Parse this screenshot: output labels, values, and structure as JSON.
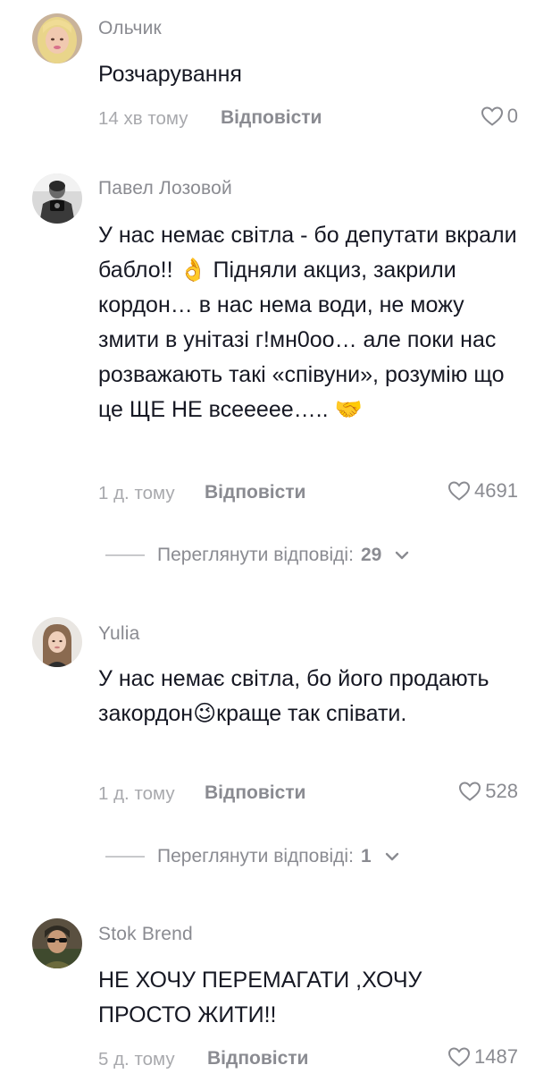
{
  "comments": [
    {
      "username": "Ольчик",
      "text": "Розчарування",
      "time": "14 хв тому",
      "reply_label": "Відповісти",
      "likes": "0",
      "avatar_icon": "avatar-blonde-woman"
    },
    {
      "username": "Павел Лозовой",
      "text": "У нас немає світла - бо депутати вкрали бабло!! 👌 Підняли акциз, закрили кордон… в нас нема води, не можу змити в унітазі г!мн0оо… але поки нас розважають такі «співуни», розумію що це ЩЕ НЕ всееееe….. 🤝",
      "time": "1 д. тому",
      "reply_label": "Відповісти",
      "likes": "4691",
      "view_replies_label": "Переглянути відповіді:",
      "view_replies_count": "29",
      "avatar_icon": "avatar-man-bw"
    },
    {
      "username": "Yulia",
      "text": "У нас немає світла, бо його продають закордон😉краще так співати.",
      "time": "1 д. тому",
      "reply_label": "Відповісти",
      "likes": "528",
      "view_replies_label": "Переглянути відповіді:",
      "view_replies_count": "1",
      "avatar_icon": "avatar-woman-brown-hair"
    },
    {
      "username": "Stok Brend",
      "text": "НЕ ХОЧУ ПЕРЕМАГАТИ ,ХОЧУ ПРОСТО ЖИТИ!!",
      "time": "5 д. тому",
      "reply_label": "Відповісти",
      "likes": "1487",
      "avatar_icon": "avatar-person-sunglasses"
    }
  ],
  "colors": {
    "text": "#161823",
    "secondary": "#8a8b91",
    "time": "#a8a9ad"
  }
}
